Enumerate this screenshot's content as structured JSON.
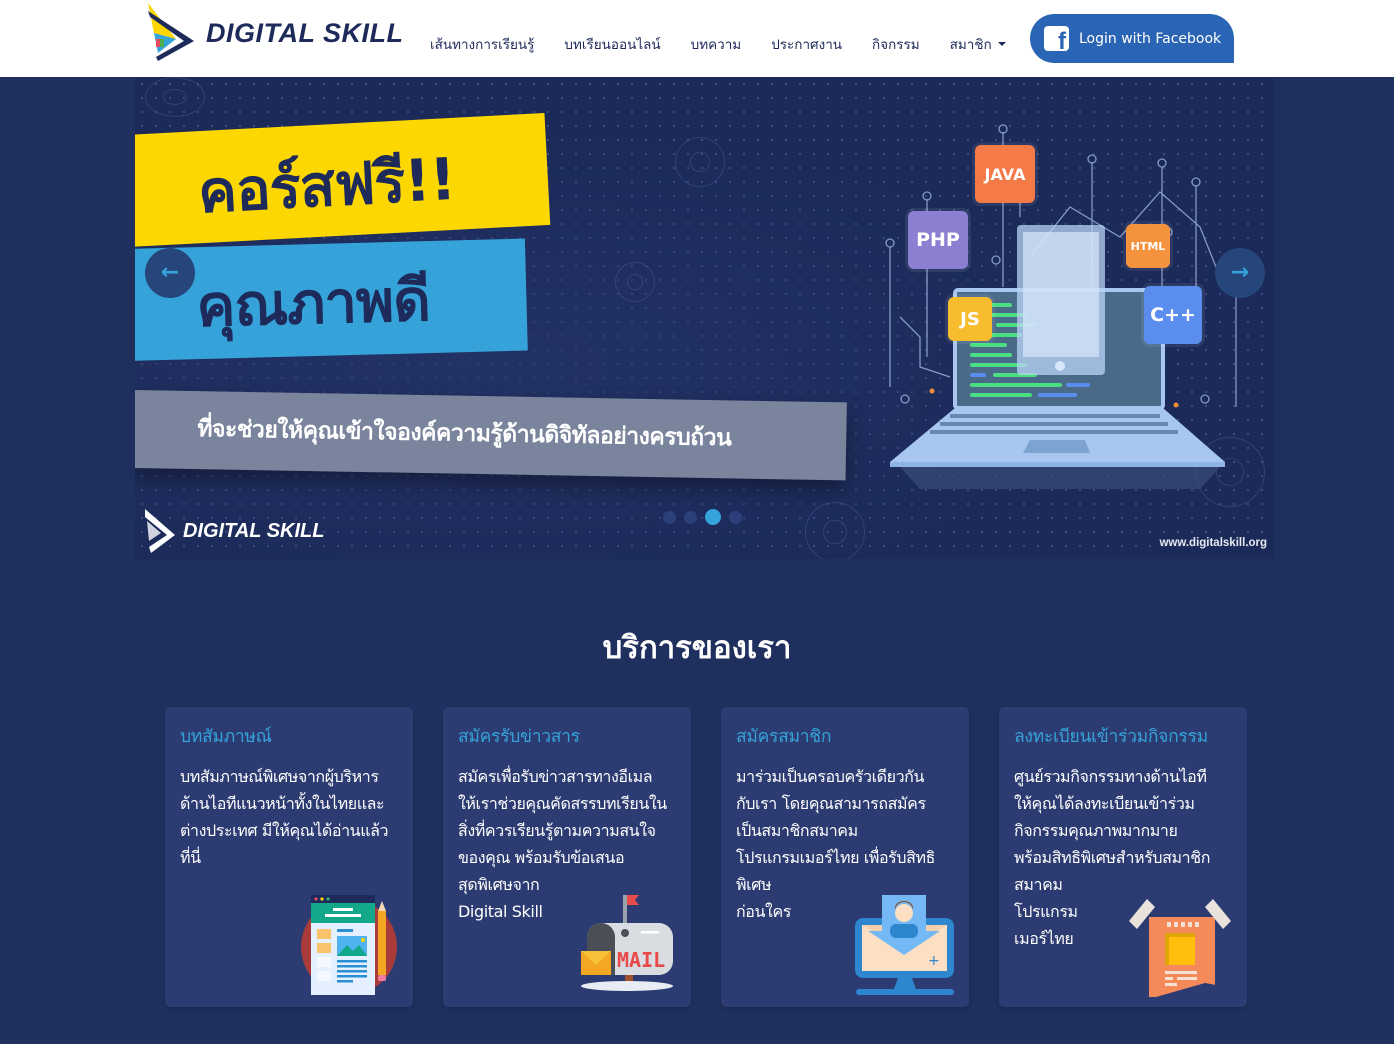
{
  "brand": {
    "name": "DIGITAL SKILL"
  },
  "nav": {
    "items": [
      {
        "label": "เส้นทางการเรียนรู้"
      },
      {
        "label": "บทเรียนออนไลน์"
      },
      {
        "label": "บทความ"
      },
      {
        "label": "ประกาศงาน"
      },
      {
        "label": "กิจกรรม"
      },
      {
        "label": "สมาชิก",
        "has_dropdown": true
      }
    ],
    "login_button": {
      "label": "Login with Facebook",
      "icon": "facebook-icon"
    }
  },
  "hero": {
    "headline_1": "คอร์สฟรี!!",
    "headline_2": "คุณภาพดี",
    "subheadline": "ที่จะช่วยให้คุณเข้าใจองค์ความรู้ด้านดิจิทัลอย่างครบถ้วน",
    "logo_text": "DIGITAL SKILL",
    "url": "www.digitalskill.org",
    "languages": [
      "JAVA",
      "PHP",
      "HTML",
      "JS",
      "C++"
    ],
    "prev_icon": "←",
    "next_icon": "→",
    "slide_count": 4,
    "active_slide": 3
  },
  "services": {
    "title": "บริการของเรา",
    "cards": [
      {
        "title": "บทสัมภาษณ์",
        "description": "บทสัมภาษณ์พิเศษจากผู้บริหาร\nด้านไอทีแนวหน้าทั้งในไทยและ\nต่างประเทศ มีให้คุณได้อ่านแล้ว\nที่นี่",
        "icon": "article-icon"
      },
      {
        "title": "สมัครรับข่าวสาร",
        "description": "สมัครเพื่อรับข่าวสารทางอีเมล\nให้เราช่วยคุณคัดสรรบทเรียนใน\nสิ่งที่ควรเรียนรู้ตามความสนใจ\nของคุณ พร้อมรับข้อเสนอ\nสุดพิเศษจาก\nDigital Skill",
        "icon": "mailbox-icon",
        "icon_text": "MAIL"
      },
      {
        "title": "สมัครสมาชิก",
        "description": "มาร่วมเป็นครอบครัวเดียวกัน\nกับเรา โดยคุณสามารถสมัคร\nเป็นสมาชิกสมาคม\nโปรแกรมเมอร์ไทย เพื่อรับสิทธิ\nพิเศษ\nก่อนใคร",
        "icon": "member-signup-icon"
      },
      {
        "title": "ลงทะเบียนเข้าร่วมกิจกรรม",
        "description": "ศูนย์รวมกิจกรรมทางด้านไอที\nให้คุณได้ลงทะเบียนเข้าร่วม\nกิจกรรมคุณภาพมากมาย\nพร้อมสิทธิพิเศษสำหรับสมาชิก\nสมาคม\nโปรแกรม\nเมอร์ไทย",
        "icon": "event-poster-icon"
      }
    ]
  },
  "colors": {
    "navy": "#1d2a5a",
    "page_bg": "#20305e",
    "card_bg": "#2c3c72",
    "accent_blue": "#35a3d9",
    "yellow": "#fcd702",
    "facebook": "#2a64b4"
  }
}
